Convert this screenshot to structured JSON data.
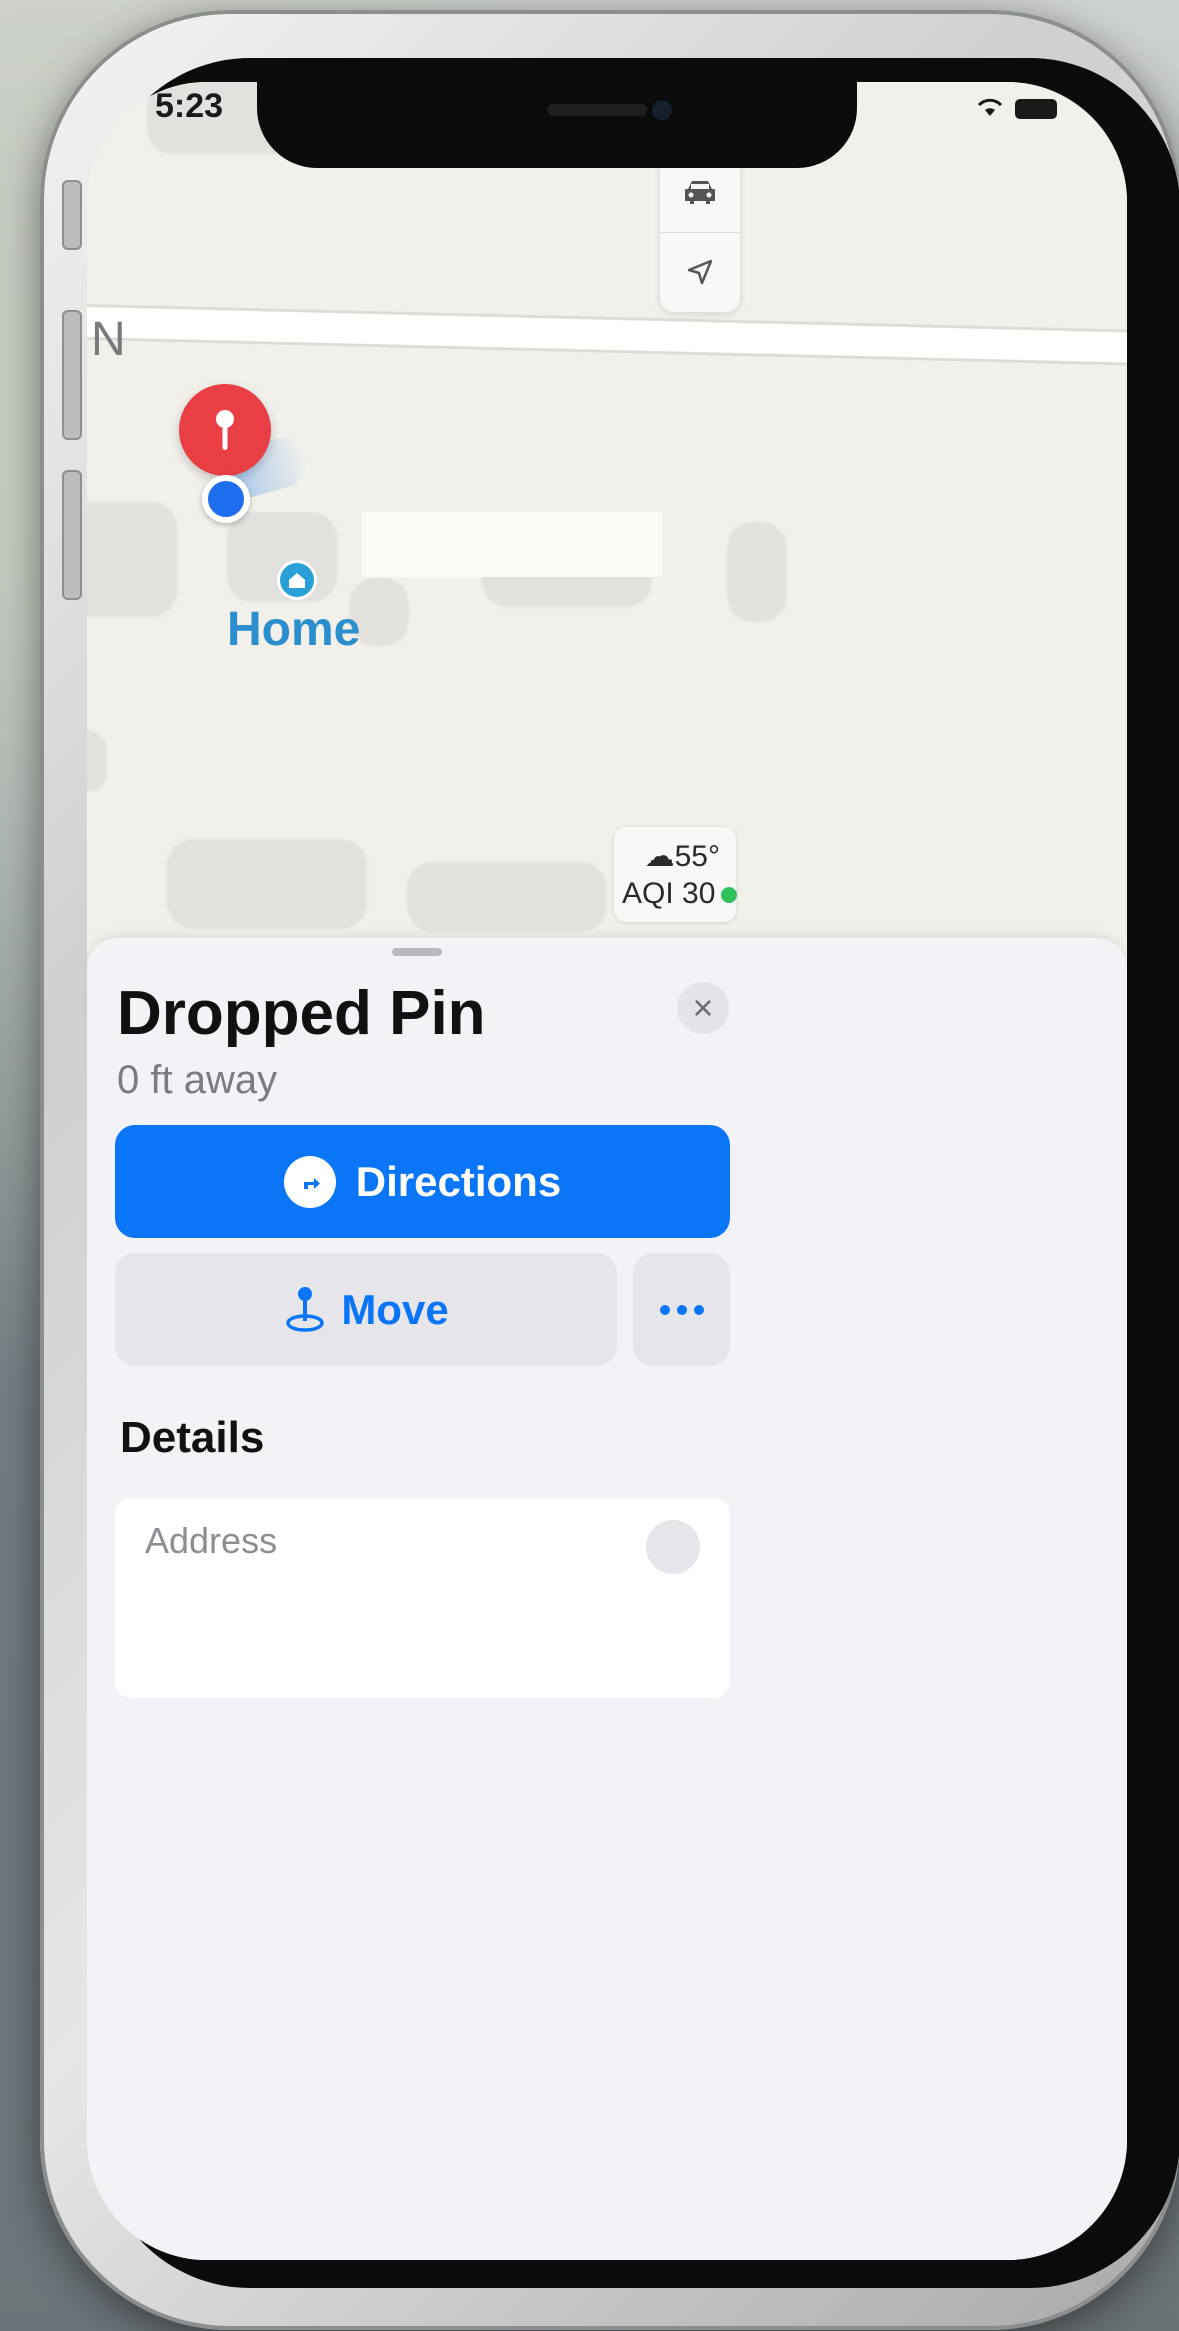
{
  "status_bar": {
    "time": "5:23"
  },
  "map": {
    "road_letter": "N",
    "home_label": "Home",
    "weather": {
      "temp": "55°",
      "aqi": "AQI 30",
      "aqi_color": "#30c25a"
    }
  },
  "sheet": {
    "title": "Dropped Pin",
    "subtitle": "0 ft away",
    "close_label": "×",
    "directions_label": "Directions",
    "move_label": "Move",
    "details_heading": "Details",
    "address_label": "Address"
  },
  "colors": {
    "accent": "#0a76f7",
    "pin": "#ea3e45",
    "location": "#1e6ff0"
  }
}
